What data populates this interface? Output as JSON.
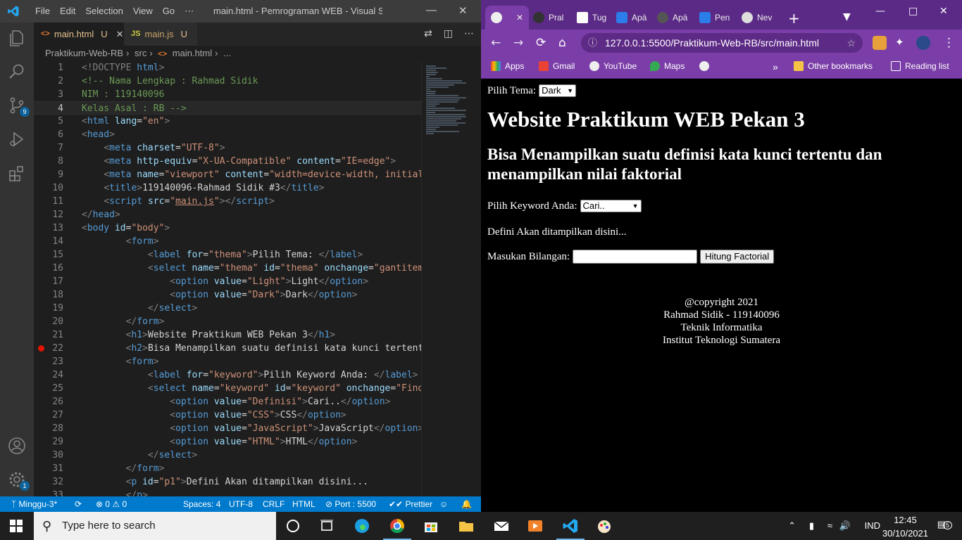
{
  "vscode": {
    "menu": [
      "File",
      "Edit",
      "Selection",
      "View",
      "Go",
      "⋯"
    ],
    "window_title": "main.html - Pemrograman WEB - Visual Stu...",
    "tabs": [
      {
        "icon": "<>",
        "label": "main.html",
        "status": "U",
        "active": true
      },
      {
        "icon": "JS",
        "label": "main.js",
        "status": "U",
        "active": false
      }
    ],
    "breadcrumb": [
      "Praktikum-Web-RB",
      "src",
      "main.html",
      "..."
    ],
    "activity_badges": {
      "source_control": "9",
      "settings": "1"
    },
    "lines": [
      [
        [
          "t-br",
          "<!DOCTYPE "
        ],
        [
          "t-tag",
          "html"
        ],
        [
          "t-br",
          ">"
        ]
      ],
      [
        [
          "t-com",
          "<!-- Nama Lengkap : Rahmad Sidik"
        ]
      ],
      [
        [
          "t-com",
          "NIM : 119140096"
        ]
      ],
      [
        [
          "t-com",
          "Kelas Asal : RB -->"
        ]
      ],
      [
        [
          "t-br",
          "<"
        ],
        [
          "t-tag",
          "html"
        ],
        [
          "t-txt",
          " "
        ],
        [
          "t-attr",
          "lang"
        ],
        [
          "t-txt",
          "="
        ],
        [
          "t-str",
          "\"en\""
        ],
        [
          "t-br",
          ">"
        ]
      ],
      [
        [
          "t-br",
          "<"
        ],
        [
          "t-tag",
          "head"
        ],
        [
          "t-br",
          ">"
        ]
      ],
      [
        [
          "t-txt",
          "    "
        ],
        [
          "t-br",
          "<"
        ],
        [
          "t-tag",
          "meta"
        ],
        [
          "t-txt",
          " "
        ],
        [
          "t-attr",
          "charset"
        ],
        [
          "t-txt",
          "="
        ],
        [
          "t-str",
          "\"UTF-8\""
        ],
        [
          "t-br",
          ">"
        ]
      ],
      [
        [
          "t-txt",
          "    "
        ],
        [
          "t-br",
          "<"
        ],
        [
          "t-tag",
          "meta"
        ],
        [
          "t-txt",
          " "
        ],
        [
          "t-attr",
          "http-equiv"
        ],
        [
          "t-txt",
          "="
        ],
        [
          "t-str",
          "\"X-UA-Compatible\""
        ],
        [
          "t-txt",
          " "
        ],
        [
          "t-attr",
          "content"
        ],
        [
          "t-txt",
          "="
        ],
        [
          "t-str",
          "\"IE=edge\""
        ],
        [
          "t-br",
          ">"
        ]
      ],
      [
        [
          "t-txt",
          "    "
        ],
        [
          "t-br",
          "<"
        ],
        [
          "t-tag",
          "meta"
        ],
        [
          "t-txt",
          " "
        ],
        [
          "t-attr",
          "name"
        ],
        [
          "t-txt",
          "="
        ],
        [
          "t-str",
          "\"viewport\""
        ],
        [
          "t-txt",
          " "
        ],
        [
          "t-attr",
          "content"
        ],
        [
          "t-txt",
          "="
        ],
        [
          "t-str",
          "\"width=device-width, initial-"
        ]
      ],
      [
        [
          "t-txt",
          "    "
        ],
        [
          "t-br",
          "<"
        ],
        [
          "t-tag",
          "title"
        ],
        [
          "t-br",
          ">"
        ],
        [
          "t-txt",
          "119140096-Rahmad Sidik #3"
        ],
        [
          "t-br",
          "</"
        ],
        [
          "t-tag",
          "title"
        ],
        [
          "t-br",
          ">"
        ]
      ],
      [
        [
          "t-txt",
          "    "
        ],
        [
          "t-br",
          "<"
        ],
        [
          "t-tag",
          "script"
        ],
        [
          "t-txt",
          " "
        ],
        [
          "t-attr",
          "src"
        ],
        [
          "t-txt",
          "="
        ],
        [
          "t-str",
          "\""
        ],
        [
          "t-link",
          "main.js"
        ],
        [
          "t-str",
          "\""
        ],
        [
          "t-br",
          "></"
        ],
        [
          "t-tag",
          "script"
        ],
        [
          "t-br",
          ">"
        ]
      ],
      [
        [
          "t-br",
          "</"
        ],
        [
          "t-tag",
          "head"
        ],
        [
          "t-br",
          ">"
        ]
      ],
      [
        [
          "t-br",
          "<"
        ],
        [
          "t-tag",
          "body"
        ],
        [
          "t-txt",
          " "
        ],
        [
          "t-attr",
          "id"
        ],
        [
          "t-txt",
          "="
        ],
        [
          "t-str",
          "\"body\""
        ],
        [
          "t-br",
          ">"
        ]
      ],
      [
        [
          "t-txt",
          "        "
        ],
        [
          "t-br",
          "<"
        ],
        [
          "t-tag",
          "form"
        ],
        [
          "t-br",
          ">"
        ]
      ],
      [
        [
          "t-txt",
          "            "
        ],
        [
          "t-br",
          "<"
        ],
        [
          "t-tag",
          "label"
        ],
        [
          "t-txt",
          " "
        ],
        [
          "t-attr",
          "for"
        ],
        [
          "t-txt",
          "="
        ],
        [
          "t-str",
          "\"thema\""
        ],
        [
          "t-br",
          ">"
        ],
        [
          "t-txt",
          "Pilih Tema: "
        ],
        [
          "t-br",
          "</"
        ],
        [
          "t-tag",
          "label"
        ],
        [
          "t-br",
          ">"
        ]
      ],
      [
        [
          "t-txt",
          "            "
        ],
        [
          "t-br",
          "<"
        ],
        [
          "t-tag",
          "select"
        ],
        [
          "t-txt",
          " "
        ],
        [
          "t-attr",
          "name"
        ],
        [
          "t-txt",
          "="
        ],
        [
          "t-str",
          "\"thema\""
        ],
        [
          "t-txt",
          " "
        ],
        [
          "t-attr",
          "id"
        ],
        [
          "t-txt",
          "="
        ],
        [
          "t-str",
          "\"thema\""
        ],
        [
          "t-txt",
          " "
        ],
        [
          "t-attr",
          "onchange"
        ],
        [
          "t-txt",
          "="
        ],
        [
          "t-str",
          "\"gantitema"
        ]
      ],
      [
        [
          "t-txt",
          "                "
        ],
        [
          "t-br",
          "<"
        ],
        [
          "t-tag",
          "option"
        ],
        [
          "t-txt",
          " "
        ],
        [
          "t-attr",
          "value"
        ],
        [
          "t-txt",
          "="
        ],
        [
          "t-str",
          "\"Light\""
        ],
        [
          "t-br",
          ">"
        ],
        [
          "t-txt",
          "Light"
        ],
        [
          "t-br",
          "</"
        ],
        [
          "t-tag",
          "option"
        ],
        [
          "t-br",
          ">"
        ]
      ],
      [
        [
          "t-txt",
          "                "
        ],
        [
          "t-br",
          "<"
        ],
        [
          "t-tag",
          "option"
        ],
        [
          "t-txt",
          " "
        ],
        [
          "t-attr",
          "value"
        ],
        [
          "t-txt",
          "="
        ],
        [
          "t-str",
          "\"Dark\""
        ],
        [
          "t-br",
          ">"
        ],
        [
          "t-txt",
          "Dark"
        ],
        [
          "t-br",
          "</"
        ],
        [
          "t-tag",
          "option"
        ],
        [
          "t-br",
          ">"
        ]
      ],
      [
        [
          "t-txt",
          "            "
        ],
        [
          "t-br",
          "</"
        ],
        [
          "t-tag",
          "select"
        ],
        [
          "t-br",
          ">"
        ]
      ],
      [
        [
          "t-txt",
          "        "
        ],
        [
          "t-br",
          "</"
        ],
        [
          "t-tag",
          "form"
        ],
        [
          "t-br",
          ">"
        ]
      ],
      [
        [
          "t-txt",
          "        "
        ],
        [
          "t-br",
          "<"
        ],
        [
          "t-tag",
          "h1"
        ],
        [
          "t-br",
          ">"
        ],
        [
          "t-txt",
          "Website Praktikum WEB Pekan 3"
        ],
        [
          "t-br",
          "</"
        ],
        [
          "t-tag",
          "h1"
        ],
        [
          "t-br",
          ">"
        ]
      ],
      [
        [
          "t-txt",
          "        "
        ],
        [
          "t-br",
          "<"
        ],
        [
          "t-tag",
          "h2"
        ],
        [
          "t-br",
          ">"
        ],
        [
          "t-txt",
          "Bisa Menampilkan suatu definisi kata kunci tertentu"
        ]
      ],
      [
        [
          "t-txt",
          "        "
        ],
        [
          "t-br",
          "<"
        ],
        [
          "t-tag",
          "form"
        ],
        [
          "t-br",
          ">"
        ]
      ],
      [
        [
          "t-txt",
          "            "
        ],
        [
          "t-br",
          "<"
        ],
        [
          "t-tag",
          "label"
        ],
        [
          "t-txt",
          " "
        ],
        [
          "t-attr",
          "for"
        ],
        [
          "t-txt",
          "="
        ],
        [
          "t-str",
          "\"keyword\""
        ],
        [
          "t-br",
          ">"
        ],
        [
          "t-txt",
          "Pilih Keyword Anda: "
        ],
        [
          "t-br",
          "</"
        ],
        [
          "t-tag",
          "label"
        ],
        [
          "t-br",
          ">"
        ]
      ],
      [
        [
          "t-txt",
          "            "
        ],
        [
          "t-br",
          "<"
        ],
        [
          "t-tag",
          "select"
        ],
        [
          "t-txt",
          " "
        ],
        [
          "t-attr",
          "name"
        ],
        [
          "t-txt",
          "="
        ],
        [
          "t-str",
          "\"keyword\""
        ],
        [
          "t-txt",
          " "
        ],
        [
          "t-attr",
          "id"
        ],
        [
          "t-txt",
          "="
        ],
        [
          "t-str",
          "\"keyword\""
        ],
        [
          "t-txt",
          " "
        ],
        [
          "t-attr",
          "onchange"
        ],
        [
          "t-txt",
          "="
        ],
        [
          "t-str",
          "\"FindK"
        ]
      ],
      [
        [
          "t-txt",
          "                "
        ],
        [
          "t-br",
          "<"
        ],
        [
          "t-tag",
          "option"
        ],
        [
          "t-txt",
          " "
        ],
        [
          "t-attr",
          "value"
        ],
        [
          "t-txt",
          "="
        ],
        [
          "t-str",
          "\"Definisi\""
        ],
        [
          "t-br",
          ">"
        ],
        [
          "t-txt",
          "Cari.."
        ],
        [
          "t-br",
          "</"
        ],
        [
          "t-tag",
          "option"
        ],
        [
          "t-br",
          ">"
        ]
      ],
      [
        [
          "t-txt",
          "                "
        ],
        [
          "t-br",
          "<"
        ],
        [
          "t-tag",
          "option"
        ],
        [
          "t-txt",
          " "
        ],
        [
          "t-attr",
          "value"
        ],
        [
          "t-txt",
          "="
        ],
        [
          "t-str",
          "\"CSS\""
        ],
        [
          "t-br",
          ">"
        ],
        [
          "t-txt",
          "CSS"
        ],
        [
          "t-br",
          "</"
        ],
        [
          "t-tag",
          "option"
        ],
        [
          "t-br",
          ">"
        ]
      ],
      [
        [
          "t-txt",
          "                "
        ],
        [
          "t-br",
          "<"
        ],
        [
          "t-tag",
          "option"
        ],
        [
          "t-txt",
          " "
        ],
        [
          "t-attr",
          "value"
        ],
        [
          "t-txt",
          "="
        ],
        [
          "t-str",
          "\"JavaScript\""
        ],
        [
          "t-br",
          ">"
        ],
        [
          "t-txt",
          "JavaScript"
        ],
        [
          "t-br",
          "</"
        ],
        [
          "t-tag",
          "option"
        ],
        [
          "t-br",
          ">"
        ]
      ],
      [
        [
          "t-txt",
          "                "
        ],
        [
          "t-br",
          "<"
        ],
        [
          "t-tag",
          "option"
        ],
        [
          "t-txt",
          " "
        ],
        [
          "t-attr",
          "value"
        ],
        [
          "t-txt",
          "="
        ],
        [
          "t-str",
          "\"HTML\""
        ],
        [
          "t-br",
          ">"
        ],
        [
          "t-txt",
          "HTML"
        ],
        [
          "t-br",
          "</"
        ],
        [
          "t-tag",
          "option"
        ],
        [
          "t-br",
          ">"
        ]
      ],
      [
        [
          "t-txt",
          "            "
        ],
        [
          "t-br",
          "</"
        ],
        [
          "t-tag",
          "select"
        ],
        [
          "t-br",
          ">"
        ]
      ],
      [
        [
          "t-txt",
          "        "
        ],
        [
          "t-br",
          "</"
        ],
        [
          "t-tag",
          "form"
        ],
        [
          "t-br",
          ">"
        ]
      ],
      [
        [
          "t-txt",
          "        "
        ],
        [
          "t-br",
          "<"
        ],
        [
          "t-tag",
          "p"
        ],
        [
          "t-txt",
          " "
        ],
        [
          "t-attr",
          "id"
        ],
        [
          "t-txt",
          "="
        ],
        [
          "t-str",
          "\"p1\""
        ],
        [
          "t-br",
          ">"
        ],
        [
          "t-txt",
          "Defini Akan ditampilkan disini..."
        ]
      ],
      [
        [
          "t-txt",
          "        "
        ],
        [
          "t-br",
          "</"
        ],
        [
          "t-tag",
          "p"
        ],
        [
          "t-br",
          ">"
        ]
      ]
    ],
    "current_line": 4,
    "breakpoint_line": 22,
    "status": {
      "branch": "Minggu-3*",
      "errors": "0",
      "warnings": "0",
      "spaces": "Spaces: 4",
      "encoding": "UTF-8",
      "eol": "CRLF",
      "language": "HTML",
      "port": "Port : 5500",
      "prettier": "Prettier"
    }
  },
  "chrome": {
    "tabs": [
      "Pral",
      "Tug",
      "Apä",
      "Apä",
      "Pen",
      "Nev"
    ],
    "url": "127.0.0.1:5500/Praktikum-Web-RB/src/main.html",
    "bookmarks": [
      "Apps",
      "Gmail",
      "YouTube",
      "Maps"
    ],
    "other_bookmarks": "Other bookmarks",
    "reading_list": "Reading list",
    "page": {
      "theme_label": "Pilih Tema:",
      "theme_value": "Dark",
      "h1": "Website Praktikum WEB Pekan 3",
      "h2": "Bisa Menampilkan suatu definisi kata kunci tertentu dan menampilkan nilai faktorial",
      "keyword_label": "Pilih Keyword Anda:",
      "keyword_value": "Cari..",
      "definition_text": "Defini Akan ditampilkan disini...",
      "number_label": "Masukan Bilangan:",
      "calc_button": "Hitung Factorial",
      "footer": [
        "@copyright 2021",
        "Rahmad Sidik - 119140096",
        "Teknik Informatika",
        "Institut Teknologi Sumatera"
      ]
    }
  },
  "taskbar": {
    "search_placeholder": "Type here to search",
    "language": "IND",
    "time": "12:45",
    "date": "30/10/2021",
    "notification_count": "5"
  },
  "colors": {
    "vscode_accent": "#007acc",
    "chrome_theme": "#7b3ea8"
  }
}
